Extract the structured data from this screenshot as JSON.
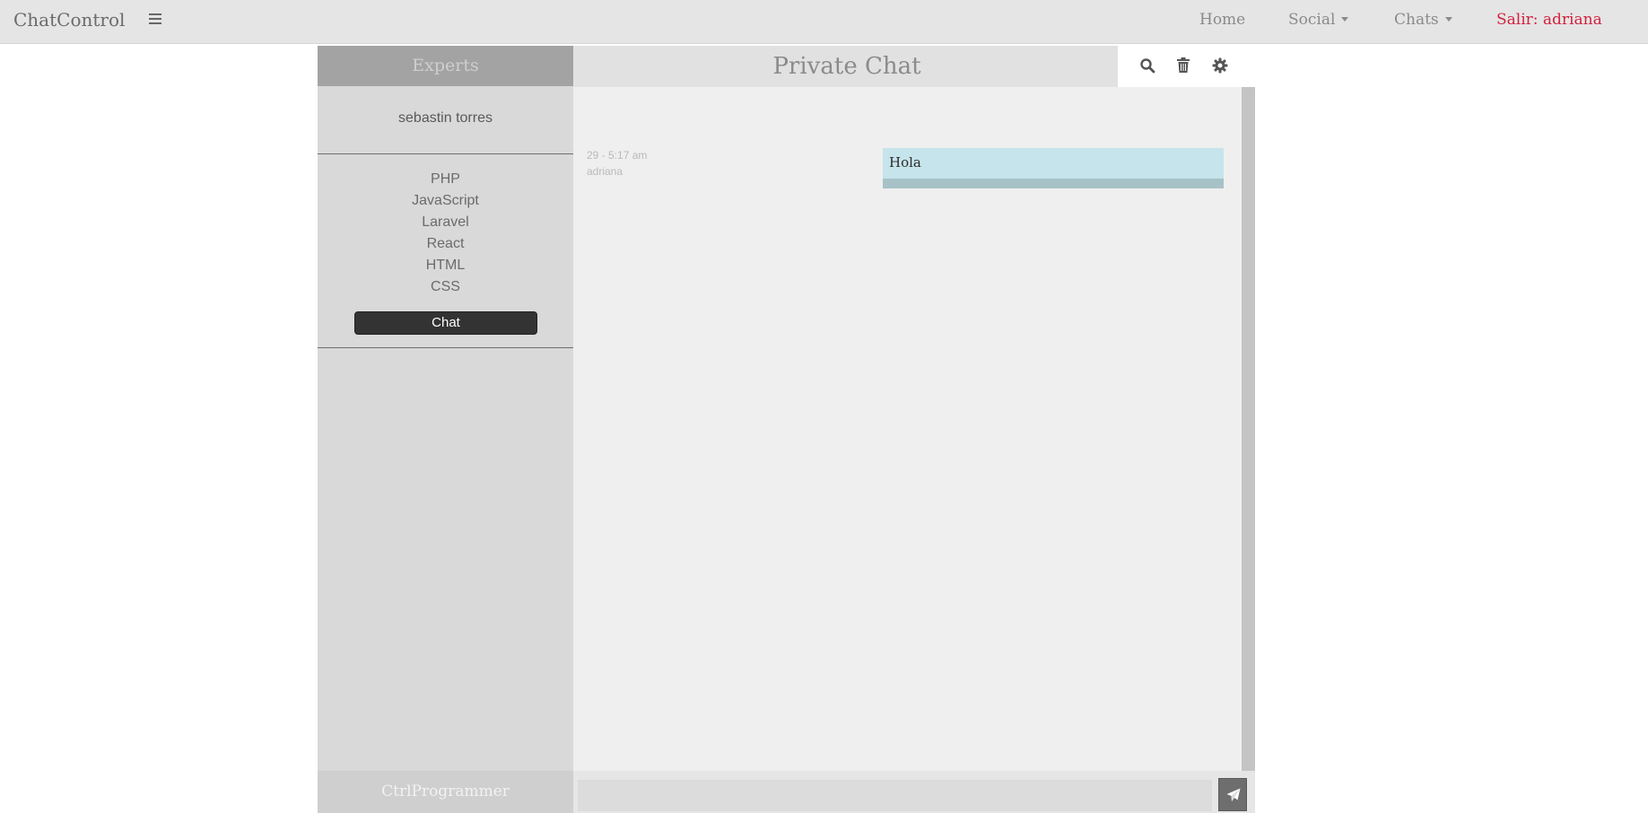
{
  "navbar": {
    "brand": "ChatControl",
    "menu_icon": "hamburger-icon",
    "links": {
      "home": "Home",
      "social": "Social",
      "chats": "Chats",
      "logout": "Salir: adriana"
    }
  },
  "sidebar": {
    "header": "Experts",
    "expert_name": "sebastin torres",
    "skills": [
      "PHP",
      "JavaScript",
      "Laravel",
      "React",
      "HTML",
      "CSS"
    ],
    "chat_button": "Chat",
    "footer": "CtrlProgrammer"
  },
  "chat": {
    "title": "Private Chat",
    "toolbar_icons": [
      "search-icon",
      "trash-icon",
      "gear-icon"
    ],
    "messages": [
      {
        "time": "29 - 5:17 am",
        "author": "adriana",
        "text": "Hola"
      }
    ],
    "composer": {
      "value": "",
      "placeholder": ""
    },
    "send_icon": "send-icon"
  },
  "colors": {
    "navbar_bg": "#e5e5e5",
    "logout": "#d1213d",
    "sidebar_header_bg": "#a3a3a3",
    "sidebar_bg": "#d9d9d9",
    "chat_bg": "#efefef",
    "bubble": "#c6e4ec",
    "chat_button_bg": "#333333"
  }
}
